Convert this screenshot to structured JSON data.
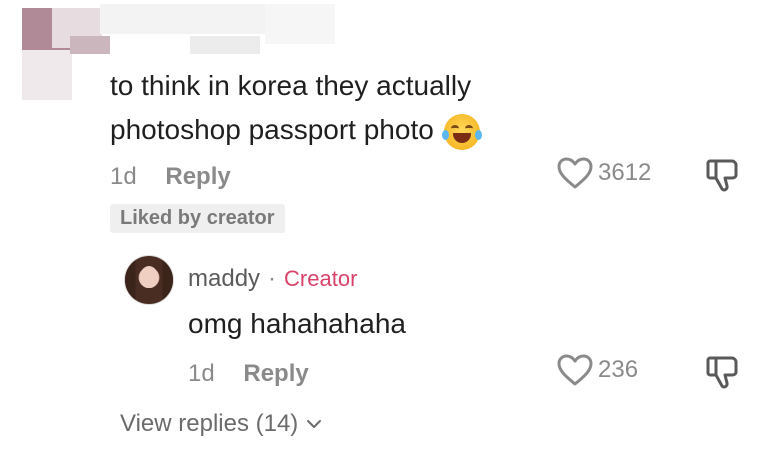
{
  "comment": {
    "line1": "to think in korea they actually",
    "line2": "photoshop passport photo",
    "emoji": "face-with-tears-of-joy",
    "time": "1d",
    "reply_label": "Reply",
    "badge": "Liked by creator",
    "likes": "3612"
  },
  "reply": {
    "username": "maddy",
    "separator": "·",
    "role": "Creator",
    "text": "omg hahahahaha",
    "time": "1d",
    "reply_label": "Reply",
    "likes": "236"
  },
  "view_replies": {
    "label": "View replies (14)"
  },
  "colors": {
    "creator": "#d9436a",
    "meta": "#8a8a8a",
    "text": "#1f1f1f"
  }
}
